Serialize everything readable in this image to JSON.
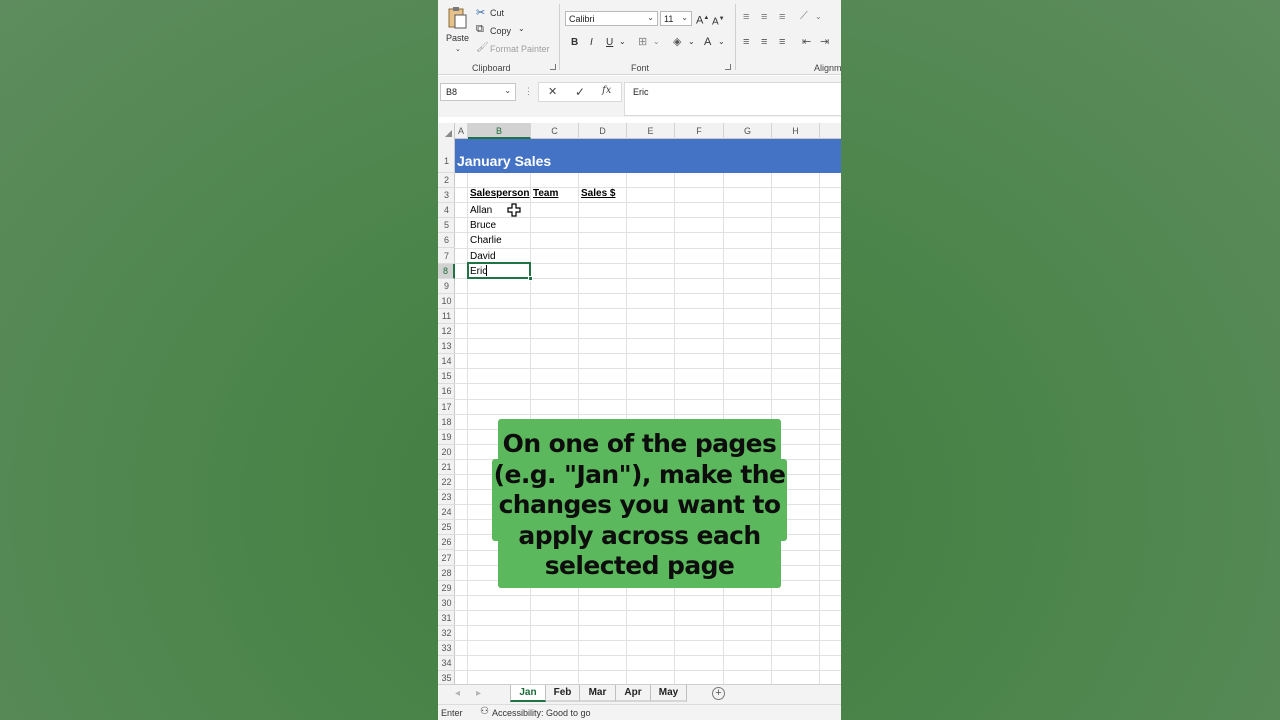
{
  "ribbon": {
    "clipboard": {
      "paste": "Paste",
      "cut": "Cut",
      "copy": "Copy",
      "format_painter": "Format Painter",
      "group_label": "Clipboard"
    },
    "font": {
      "family": "Calibri",
      "size": "11",
      "bold": "B",
      "italic": "I",
      "underline": "U",
      "group_label": "Font"
    },
    "alignment": {
      "group_label": "Alignm"
    }
  },
  "formula_bar": {
    "name_box": "B8",
    "cancel": "✕",
    "enter": "✓",
    "fx": "fx",
    "value": "Eric"
  },
  "columns": [
    "A",
    "B",
    "C",
    "D",
    "E",
    "F",
    "G",
    "H"
  ],
  "rows": [
    "1",
    "2",
    "3",
    "4",
    "5",
    "6",
    "7",
    "8",
    "9",
    "10",
    "11",
    "12",
    "13",
    "14",
    "15",
    "16",
    "17",
    "18",
    "19",
    "20",
    "21",
    "22",
    "23",
    "24",
    "25",
    "26",
    "27",
    "28",
    "29",
    "30",
    "31",
    "32",
    "33",
    "34",
    "35"
  ],
  "sheet": {
    "title": "January Sales",
    "headers": {
      "salesperson": "Salesperson",
      "team": "Team",
      "sales": "Sales $"
    },
    "salespeople": [
      "Allan",
      "Bruce",
      "Charlie",
      "David",
      "Eric"
    ]
  },
  "tabs": [
    "Jan",
    "Feb",
    "Mar",
    "Apr",
    "May"
  ],
  "active_tab": "Jan",
  "status": {
    "mode": "Enter",
    "accessibility": "Accessibility: Good to go"
  },
  "caption": "On one of the pages (e.g. \"Jan\"), make the changes you want to apply across each selected page",
  "colors": {
    "title_band": "#4472c4",
    "excel_green": "#217346",
    "caption_bg": "#5cb85c"
  }
}
